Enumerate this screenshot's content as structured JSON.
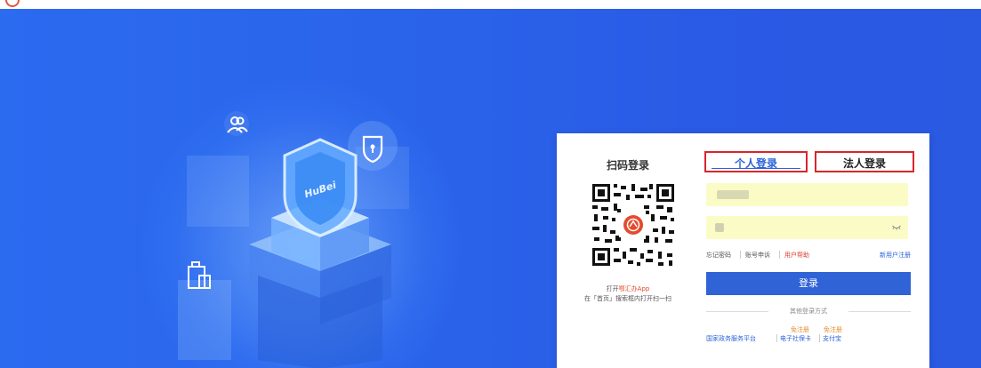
{
  "qr_panel": {
    "title": "扫码登录",
    "hint_prefix": "打开",
    "hint_app": "鄂汇办App",
    "hint_line2": "在「首页」搜索框内打开扫一扫"
  },
  "tabs": {
    "personal": "个人登录",
    "legal": "法人登录"
  },
  "links": {
    "forgot": "忘记密码",
    "appeal": "账号申诉",
    "help": "用户帮助",
    "register": "新用户注册"
  },
  "login_button": "登录",
  "other_login": {
    "title": "其他登录方式",
    "gov": "国家政务服务平台",
    "card": "电子社保卡",
    "alipay": "支付宝",
    "badge_card": "免注册",
    "badge_alipay": "免注册"
  },
  "illustration": {
    "shield_text": "HuBei"
  },
  "colors": {
    "hero_blue": "#2a63ea",
    "tab_border": "#d8262c",
    "primary": "#2f63d6",
    "help_red": "#e03a2a",
    "badge_orange": "#e78b2d"
  }
}
